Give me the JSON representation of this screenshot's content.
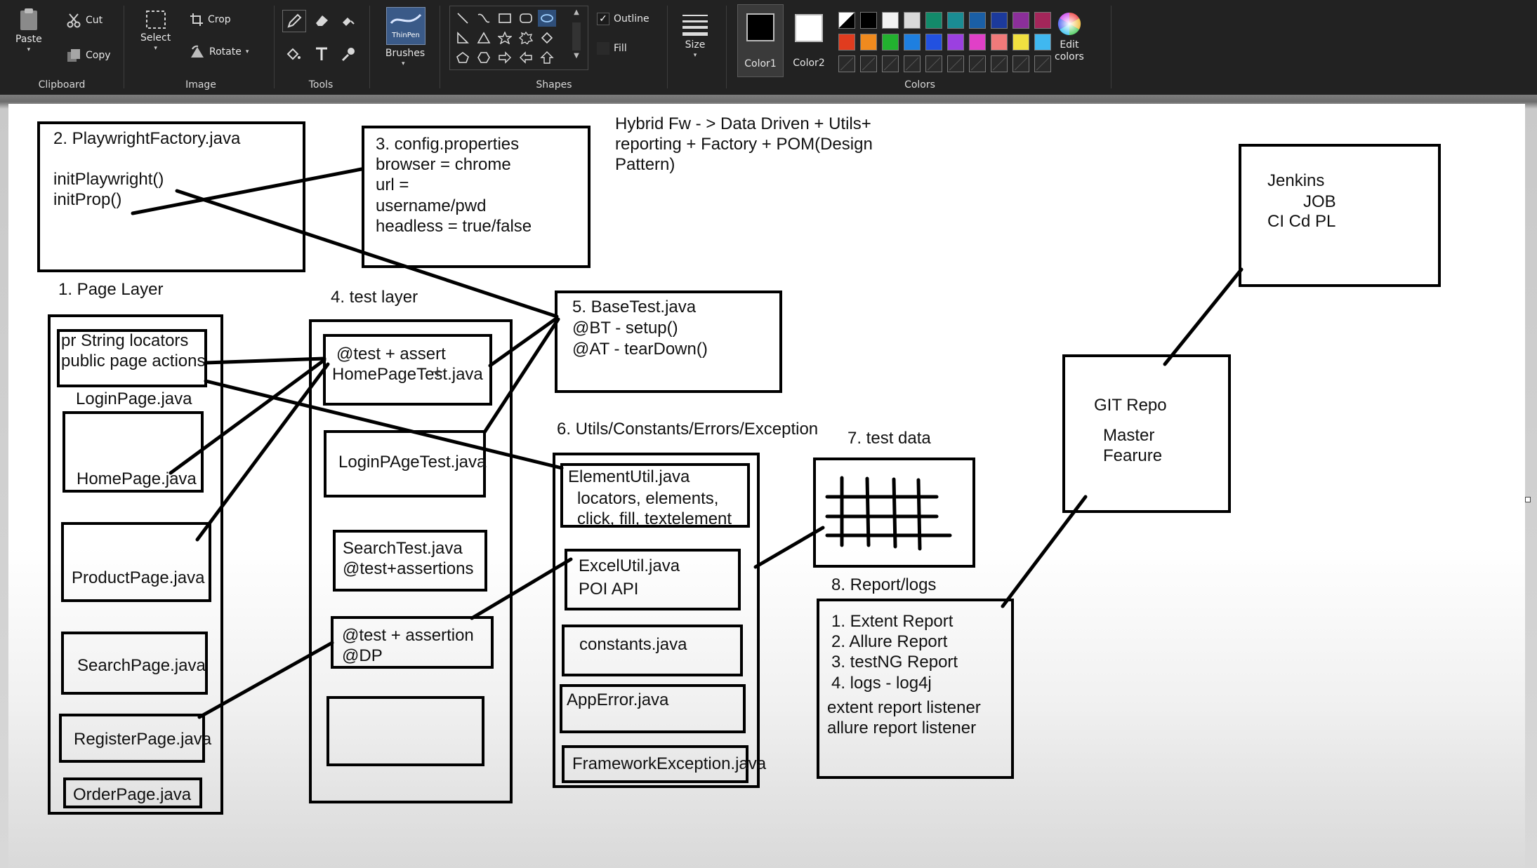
{
  "ribbon": {
    "clipboard": {
      "label": "Clipboard",
      "paste": "Paste",
      "cut": "Cut",
      "copy": "Copy"
    },
    "image": {
      "label": "Image",
      "select": "Select",
      "crop": "Crop",
      "rotate": "Rotate"
    },
    "tools": {
      "label": "Tools"
    },
    "brushes": {
      "label": "Brushes",
      "preview_text": "ThinPen"
    },
    "shapes": {
      "label": "Shapes",
      "outline": "Outline",
      "fill": "Fill"
    },
    "size": {
      "label": "Size"
    },
    "colors": {
      "label": "Colors",
      "color1_label": "Color1",
      "color2_label": "Color2",
      "color1": "#000000",
      "color2": "#ffffff",
      "edit_label_1": "Edit",
      "edit_label_2": "colors",
      "palette_row1": [
        "#000000",
        "#000000",
        "#f2f2f2",
        "#d9d9d9",
        "#138a6a",
        "#1a8c93",
        "#1a5fa6",
        "#1c3a9c",
        "#8b2f9a",
        "#a3265a"
      ],
      "palette_row2": [
        "#e03c1f",
        "#f08a1e",
        "#22b22f",
        "#1e7fe0",
        "#2251e0",
        "#9b40e0",
        "#e040c7",
        "#f07a7a",
        "#f0e040",
        "#40b8f0"
      ]
    }
  },
  "diagram": {
    "title": [
      "Hybrid Fw - > Data Driven + Utils+",
      "reporting + Factory + POM(Design",
      "Pattern)"
    ],
    "factory": {
      "lines": [
        "2. PlaywrightFactory.java",
        "",
        "initPlaywright()",
        "initProp()"
      ]
    },
    "config": {
      "lines": [
        "3. config.properties",
        "browser = chrome",
        "url =",
        "username/pwd",
        "headless = true/false"
      ]
    },
    "jenkins": {
      "lines": [
        "Jenkins",
        "JOB",
        "CI Cd PL"
      ]
    },
    "page_layer": {
      "label": "1. Page Layer",
      "header": [
        "pr String locators",
        "public page actions"
      ],
      "login_label": "LoginPage.java",
      "pages": [
        "HomePage.java",
        "ProductPage.java",
        "SearchPage.java",
        "RegisterPage.java",
        "OrderPage.java"
      ]
    },
    "test_layer": {
      "label": "4. test layer",
      "home_test": [
        "@test + assert",
        "HomePageTest.java"
      ],
      "login_test": "LoginPAgeTest.java",
      "search_test": [
        "SearchTest.java",
        "@test+assertions"
      ],
      "dp_test": [
        "@test + assertion",
        "@DP"
      ]
    },
    "base_test": {
      "lines": [
        "5. BaseTest.java",
        "@BT - setup()",
        "@AT - tearDown()"
      ]
    },
    "utils": {
      "label": "6. Utils/Constants/Errors/Exception",
      "element_util": [
        "ElementUtil.java",
        "locators, elements,",
        "click, fill, textelement"
      ],
      "excel_util": [
        "ExcelUtil.java",
        "POI API"
      ],
      "constants": "constants.java",
      "app_error": "AppError.java",
      "framework_exception": "FrameworkException.java"
    },
    "test_data": {
      "label": "7. test data"
    },
    "report": {
      "label": "8. Report/logs",
      "lines": [
        "1. Extent Report",
        "2. Allure Report",
        "3. testNG Report",
        "4. logs - log4j",
        "extent report listener",
        "allure report listener"
      ]
    },
    "git": {
      "lines": [
        "GIT Repo",
        "Master",
        "Fearure"
      ]
    }
  }
}
